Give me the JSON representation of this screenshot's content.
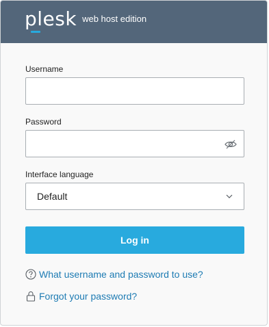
{
  "header": {
    "logo_text": "plesk",
    "edition": "web host edition"
  },
  "form": {
    "username": {
      "label": "Username",
      "value": "",
      "placeholder": ""
    },
    "password": {
      "label": "Password",
      "value": "",
      "placeholder": "",
      "visibility_icon": "eye-off-icon"
    },
    "language": {
      "label": "Interface language",
      "selected": "Default",
      "icon": "chevron-down-icon"
    },
    "submit_label": "Log in"
  },
  "links": {
    "help": {
      "icon": "question-circle-icon",
      "text": "What username and password to use?"
    },
    "forgot": {
      "icon": "lock-icon",
      "text": "Forgot your password?"
    }
  },
  "colors": {
    "header_bg": "#53667a",
    "accent": "#28aade",
    "link": "#1d7bb3"
  }
}
